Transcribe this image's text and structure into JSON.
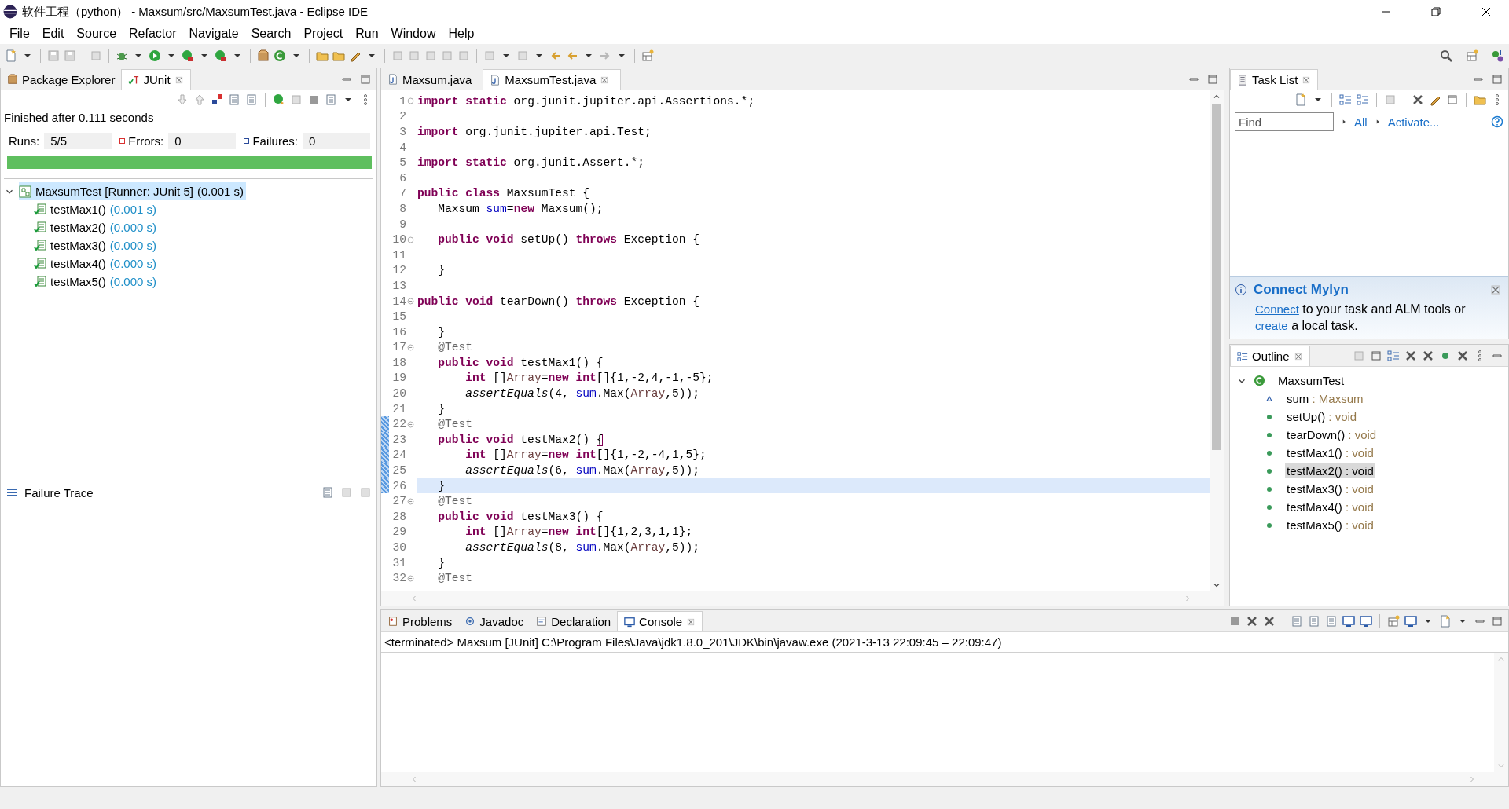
{
  "window": {
    "title": "软件工程（python） - Maxsum/src/MaxsumTest.java - Eclipse IDE"
  },
  "menu": [
    "File",
    "Edit",
    "Source",
    "Refactor",
    "Navigate",
    "Search",
    "Project",
    "Run",
    "Window",
    "Help"
  ],
  "junit_view": {
    "tabs": [
      {
        "label": "Package Explorer",
        "selected": false
      },
      {
        "label": "JUnit",
        "selected": true
      }
    ],
    "status": "Finished after 0.111 seconds",
    "counters": [
      {
        "kind": "runs",
        "label": "Runs:",
        "value": "5/5"
      },
      {
        "kind": "errors",
        "label": "Errors:",
        "value": "0"
      },
      {
        "kind": "failures",
        "label": "Failures:",
        "value": "0"
      }
    ],
    "progress": {
      "level": 1
    },
    "tree": {
      "label": "MaxsumTest [Runner: JUnit 5]",
      "time": "(0.001 s)",
      "expanded": true,
      "selected": true,
      "children": [
        {
          "label": "testMax1()",
          "time": "(0.001 s)",
          "selected": false
        },
        {
          "label": "testMax2()",
          "time": "(0.000 s)",
          "selected": false
        },
        {
          "label": "testMax3()",
          "time": "(0.000 s)",
          "selected": false
        },
        {
          "label": "testMax4()",
          "time": "(0.000 s)",
          "selected": false
        },
        {
          "label": "testMax5()",
          "time": "(0.000 s)",
          "selected": false
        }
      ]
    },
    "failure_trace": {
      "title": "Failure Trace"
    }
  },
  "editor": {
    "tabs": [
      {
        "label": "Maxsum.java",
        "selected": false
      },
      {
        "label": "MaxsumTest.java",
        "selected": true
      }
    ],
    "lines": [
      {
        "number": "1",
        "foldable": true,
        "changed": false,
        "current": false,
        "tokens": [
          {
            "kind": "keyword",
            "text": "import static"
          },
          {
            "kind": "plain",
            "text": " org.junit.jupiter.api.Assertions.*;"
          }
        ]
      },
      {
        "number": "2",
        "foldable": false,
        "changed": false,
        "current": false
      },
      {
        "number": "3",
        "foldable": false,
        "changed": false,
        "current": false,
        "tokens": [
          {
            "kind": "keyword",
            "text": "import"
          },
          {
            "kind": "plain",
            "text": " org.junit.jupiter.api.Test;"
          }
        ]
      },
      {
        "number": "4",
        "foldable": false,
        "changed": false,
        "current": false
      },
      {
        "number": "5",
        "foldable": false,
        "changed": false,
        "current": false,
        "tokens": [
          {
            "kind": "keyword",
            "text": "import static"
          },
          {
            "kind": "plain",
            "text": " org.junit.Assert.*;"
          }
        ]
      },
      {
        "number": "6",
        "foldable": false,
        "changed": false,
        "current": false
      },
      {
        "number": "7",
        "foldable": false,
        "changed": false,
        "current": false,
        "tokens": [
          {
            "kind": "keyword",
            "text": "public class"
          },
          {
            "kind": "plain",
            "text": " MaxsumTest {"
          }
        ]
      },
      {
        "number": "8",
        "foldable": false,
        "changed": false,
        "current": false,
        "tokens": [
          {
            "kind": "plain",
            "text": "   Maxsum "
          },
          {
            "kind": "field",
            "text": "sum"
          },
          {
            "kind": "plain",
            "text": "="
          },
          {
            "kind": "keyword",
            "text": "new"
          },
          {
            "kind": "plain",
            "text": " Maxsum();"
          }
        ]
      },
      {
        "number": "9",
        "foldable": false,
        "changed": false,
        "current": false
      },
      {
        "number": "10",
        "foldable": true,
        "changed": false,
        "current": false,
        "tokens": [
          {
            "kind": "keyword",
            "text": "   public void"
          },
          {
            "kind": "plain",
            "text": " setUp() "
          },
          {
            "kind": "keyword",
            "text": "throws"
          },
          {
            "kind": "plain",
            "text": " Exception {"
          }
        ]
      },
      {
        "number": "11",
        "foldable": false,
        "changed": false,
        "current": false
      },
      {
        "number": "12",
        "foldable": false,
        "changed": false,
        "current": false,
        "tokens": [
          {
            "kind": "plain",
            "text": "   }"
          }
        ]
      },
      {
        "number": "13",
        "foldable": false,
        "changed": false,
        "current": false
      },
      {
        "number": "14",
        "foldable": true,
        "changed": false,
        "current": false,
        "tokens": [
          {
            "kind": "keyword",
            "text": "public void"
          },
          {
            "kind": "plain",
            "text": " tearDown() "
          },
          {
            "kind": "keyword",
            "text": "throws"
          },
          {
            "kind": "plain",
            "text": " Exception {"
          }
        ]
      },
      {
        "number": "15",
        "foldable": false,
        "changed": false,
        "current": false
      },
      {
        "number": "16",
        "foldable": false,
        "changed": false,
        "current": false,
        "tokens": [
          {
            "kind": "plain",
            "text": "   }"
          }
        ]
      },
      {
        "number": "17",
        "foldable": true,
        "changed": false,
        "current": false,
        "tokens": [
          {
            "kind": "annotation",
            "text": "   @Test"
          }
        ]
      },
      {
        "number": "18",
        "foldable": false,
        "changed": false,
        "current": false,
        "tokens": [
          {
            "kind": "keyword",
            "text": "   public void"
          },
          {
            "kind": "plain",
            "text": " testMax1() {"
          }
        ]
      },
      {
        "number": "19",
        "foldable": false,
        "changed": false,
        "current": false,
        "tokens": [
          {
            "kind": "keyword",
            "text": "       int"
          },
          {
            "kind": "plain",
            "text": " []"
          },
          {
            "kind": "local",
            "text": "Array"
          },
          {
            "kind": "plain",
            "text": "="
          },
          {
            "kind": "keyword",
            "text": "new int"
          },
          {
            "kind": "plain",
            "text": "[]{1,-2,4,-1,-5};"
          }
        ]
      },
      {
        "number": "20",
        "foldable": false,
        "changed": false,
        "current": false,
        "tokens": [
          {
            "kind": "static",
            "text": "       assertEquals"
          },
          {
            "kind": "plain",
            "text": "(4, "
          },
          {
            "kind": "field",
            "text": "sum"
          },
          {
            "kind": "plain",
            "text": ".Max("
          },
          {
            "kind": "local",
            "text": "Array"
          },
          {
            "kind": "plain",
            "text": ",5));"
          }
        ]
      },
      {
        "number": "21",
        "foldable": false,
        "changed": false,
        "current": false,
        "tokens": [
          {
            "kind": "plain",
            "text": "   }"
          }
        ]
      },
      {
        "number": "22",
        "foldable": true,
        "changed": true,
        "current": false,
        "tokens": [
          {
            "kind": "annotation",
            "text": "   @Test"
          }
        ]
      },
      {
        "number": "23",
        "foldable": false,
        "changed": true,
        "current": false,
        "tokens": [
          {
            "kind": "keyword",
            "text": "   public void"
          },
          {
            "kind": "plain",
            "text": " testMax2() "
          },
          {
            "kind": "bracket",
            "text": "{"
          }
        ]
      },
      {
        "number": "24",
        "foldable": false,
        "changed": true,
        "current": false,
        "tokens": [
          {
            "kind": "keyword",
            "text": "       int"
          },
          {
            "kind": "plain",
            "text": " []"
          },
          {
            "kind": "local",
            "text": "Array"
          },
          {
            "kind": "plain",
            "text": "="
          },
          {
            "kind": "keyword",
            "text": "new int"
          },
          {
            "kind": "plain",
            "text": "[]{1,-2,-4,1,5};"
          }
        ]
      },
      {
        "number": "25",
        "foldable": false,
        "changed": true,
        "current": false,
        "tokens": [
          {
            "kind": "static",
            "text": "       assertEquals"
          },
          {
            "kind": "plain",
            "text": "(6, "
          },
          {
            "kind": "field",
            "text": "sum"
          },
          {
            "kind": "plain",
            "text": ".Max("
          },
          {
            "kind": "local",
            "text": "Array"
          },
          {
            "kind": "plain",
            "text": ",5));"
          }
        ]
      },
      {
        "number": "26",
        "foldable": false,
        "changed": true,
        "current": true,
        "tokens": [
          {
            "kind": "plain",
            "text": "   }"
          }
        ]
      },
      {
        "number": "27",
        "foldable": true,
        "changed": false,
        "current": false,
        "tokens": [
          {
            "kind": "annotation",
            "text": "   @Test"
          }
        ]
      },
      {
        "number": "28",
        "foldable": false,
        "changed": false,
        "current": false,
        "tokens": [
          {
            "kind": "keyword",
            "text": "   public void"
          },
          {
            "kind": "plain",
            "text": " testMax3() {"
          }
        ]
      },
      {
        "number": "29",
        "foldable": false,
        "changed": false,
        "current": false,
        "tokens": [
          {
            "kind": "keyword",
            "text": "       int"
          },
          {
            "kind": "plain",
            "text": " []"
          },
          {
            "kind": "local",
            "text": "Array"
          },
          {
            "kind": "plain",
            "text": "="
          },
          {
            "kind": "keyword",
            "text": "new int"
          },
          {
            "kind": "plain",
            "text": "[]{1,2,3,1,1};"
          }
        ]
      },
      {
        "number": "30",
        "foldable": false,
        "changed": false,
        "current": false,
        "tokens": [
          {
            "kind": "static",
            "text": "       assertEquals"
          },
          {
            "kind": "plain",
            "text": "(8, "
          },
          {
            "kind": "field",
            "text": "sum"
          },
          {
            "kind": "plain",
            "text": ".Max("
          },
          {
            "kind": "local",
            "text": "Array"
          },
          {
            "kind": "plain",
            "text": ",5));"
          }
        ]
      },
      {
        "number": "31",
        "foldable": false,
        "changed": false,
        "current": false,
        "tokens": [
          {
            "kind": "plain",
            "text": "   }"
          }
        ]
      },
      {
        "number": "32",
        "foldable": true,
        "changed": false,
        "current": false,
        "tokens": [
          {
            "kind": "annotation",
            "text": "   @Test"
          }
        ]
      }
    ]
  },
  "task_list": {
    "tab": "Task List",
    "find": {
      "placeholder": "Find"
    },
    "links": [
      "All",
      "Activate..."
    ],
    "connect": {
      "title": "Connect Mylyn",
      "message": [
        {
          "kind": "link",
          "text": "Connect"
        },
        {
          "kind": "text",
          "text": " to your task and ALM tools or "
        },
        {
          "kind": "link",
          "text": "create"
        },
        {
          "kind": "text",
          "text": " a local task."
        }
      ]
    }
  },
  "outline": {
    "tab": "Outline",
    "root": {
      "label": "MaxsumTest",
      "expanded": true
    },
    "items": [
      {
        "kind": "field",
        "name": "sum",
        "type": ": Maxsum",
        "selected": false
      },
      {
        "kind": "method",
        "name": "setUp()",
        "type": ": void",
        "selected": false
      },
      {
        "kind": "method",
        "name": "tearDown()",
        "type": ": void",
        "selected": false
      },
      {
        "kind": "method",
        "name": "testMax1()",
        "type": ": void",
        "selected": false
      },
      {
        "kind": "method",
        "name": "testMax2()",
        "type": ": void",
        "selected": true
      },
      {
        "kind": "method",
        "name": "testMax3()",
        "type": ": void",
        "selected": false
      },
      {
        "kind": "method",
        "name": "testMax4()",
        "type": ": void",
        "selected": false
      },
      {
        "kind": "method",
        "name": "testMax5()",
        "type": ": void",
        "selected": false
      }
    ]
  },
  "console": {
    "tabs": [
      {
        "label": "Problems",
        "selected": false
      },
      {
        "label": "Javadoc",
        "selected": false
      },
      {
        "label": "Declaration",
        "selected": false
      },
      {
        "label": "Console",
        "selected": true
      }
    ],
    "header": "<terminated> Maxsum [JUnit] C:\\Program Files\\Java\\jdk1.8.0_201\\JDK\\bin\\javaw.exe  (2021-3-13 22:09:45 – 22:09:47)"
  }
}
